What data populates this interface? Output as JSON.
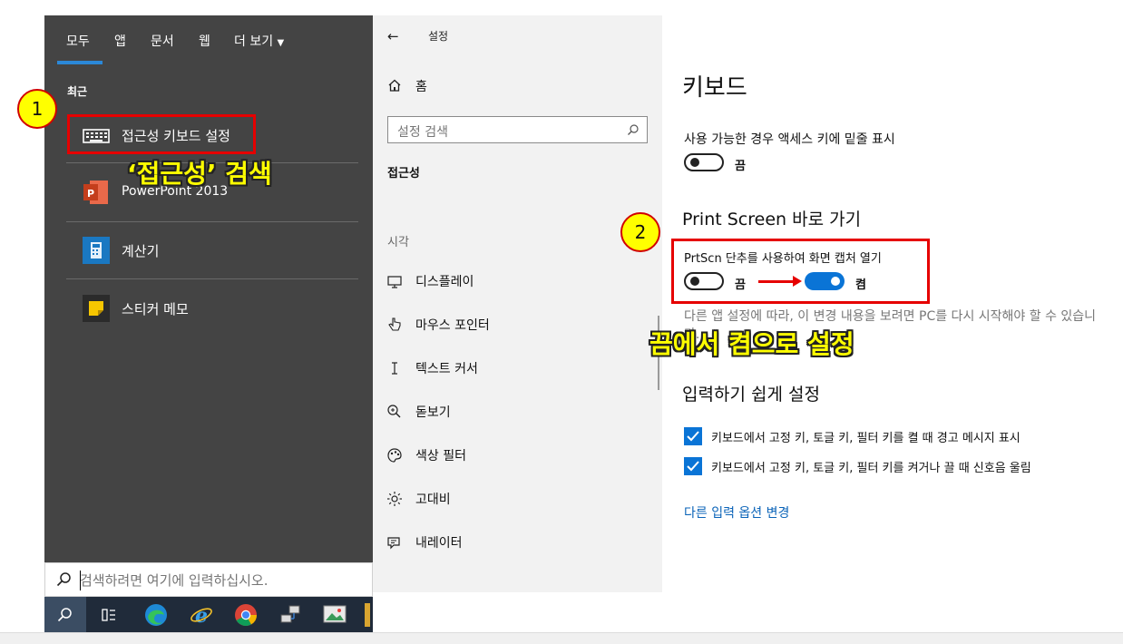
{
  "start_menu": {
    "tabs": [
      "모두",
      "앱",
      "문서",
      "웹",
      "더 보기"
    ],
    "section_label": "최근",
    "results": [
      {
        "label": "접근성 키보드 설정",
        "icon": "keyboard-icon"
      },
      {
        "label": "PowerPoint 2013",
        "icon": "powerpoint-icon"
      },
      {
        "label": "계산기",
        "icon": "calculator-icon"
      },
      {
        "label": "스티커 메모",
        "icon": "sticky-notes-icon"
      }
    ],
    "search_placeholder": "검색하려면 여기에 입력하십시오.",
    "taskbar": [
      "search-icon",
      "task-view-icon",
      "edge-icon",
      "ie-icon",
      "chrome-icon",
      "network-icon",
      "photos-icon"
    ]
  },
  "settings_nav": {
    "back": "←",
    "title": "설정",
    "home": "홈",
    "search_placeholder": "설정 검색",
    "category": "접근성",
    "group": "시각",
    "items": [
      {
        "label": "디스플레이",
        "icon": "display-icon"
      },
      {
        "label": "마우스 포인터",
        "icon": "mouse-pointer-icon"
      },
      {
        "label": "텍스트 커서",
        "icon": "text-cursor-icon"
      },
      {
        "label": "돋보기",
        "icon": "magnifier-icon"
      },
      {
        "label": "색상 필터",
        "icon": "color-filter-icon"
      },
      {
        "label": "고대비",
        "icon": "high-contrast-icon"
      },
      {
        "label": "내레이터",
        "icon": "narrator-icon"
      }
    ]
  },
  "content": {
    "heading": "키보드",
    "access_keys_label": "사용 가능한 경우 액세스 키에 밑줄 표시",
    "access_keys_state": "끔",
    "print_screen_heading": "Print Screen 바로 가기",
    "prtscn_label": "PrtScn 단추를 사용하여 화면 캡처 열기",
    "prtscn_state_before": "끔",
    "prtscn_state_after": "켬",
    "restart_note": "다른 앱 설정에 따라, 이 변경 내용을 보려면 PC를 다시 시작해야 할 수 있습니다.",
    "typing_heading": "입력하기 쉽게 설정",
    "checkboxes": [
      "키보드에서 고정 키, 토글 키, 필터 키를 켤 때 경고 메시지 표시",
      "키보드에서 고정 키, 토글 키, 필터 키를 켜거나 끌 때 신호음 울림"
    ],
    "link": "다른 입력 옵션 변경"
  },
  "annotations": {
    "badge1": "1",
    "badge2": "2",
    "search_note": "‘접근성’ 검색",
    "toggle_note": "끔에서 켬으로 설정",
    "colors": {
      "badge_fill": "#ffff00",
      "box": "#e60000",
      "toggle_on": "#0a74d6"
    }
  }
}
